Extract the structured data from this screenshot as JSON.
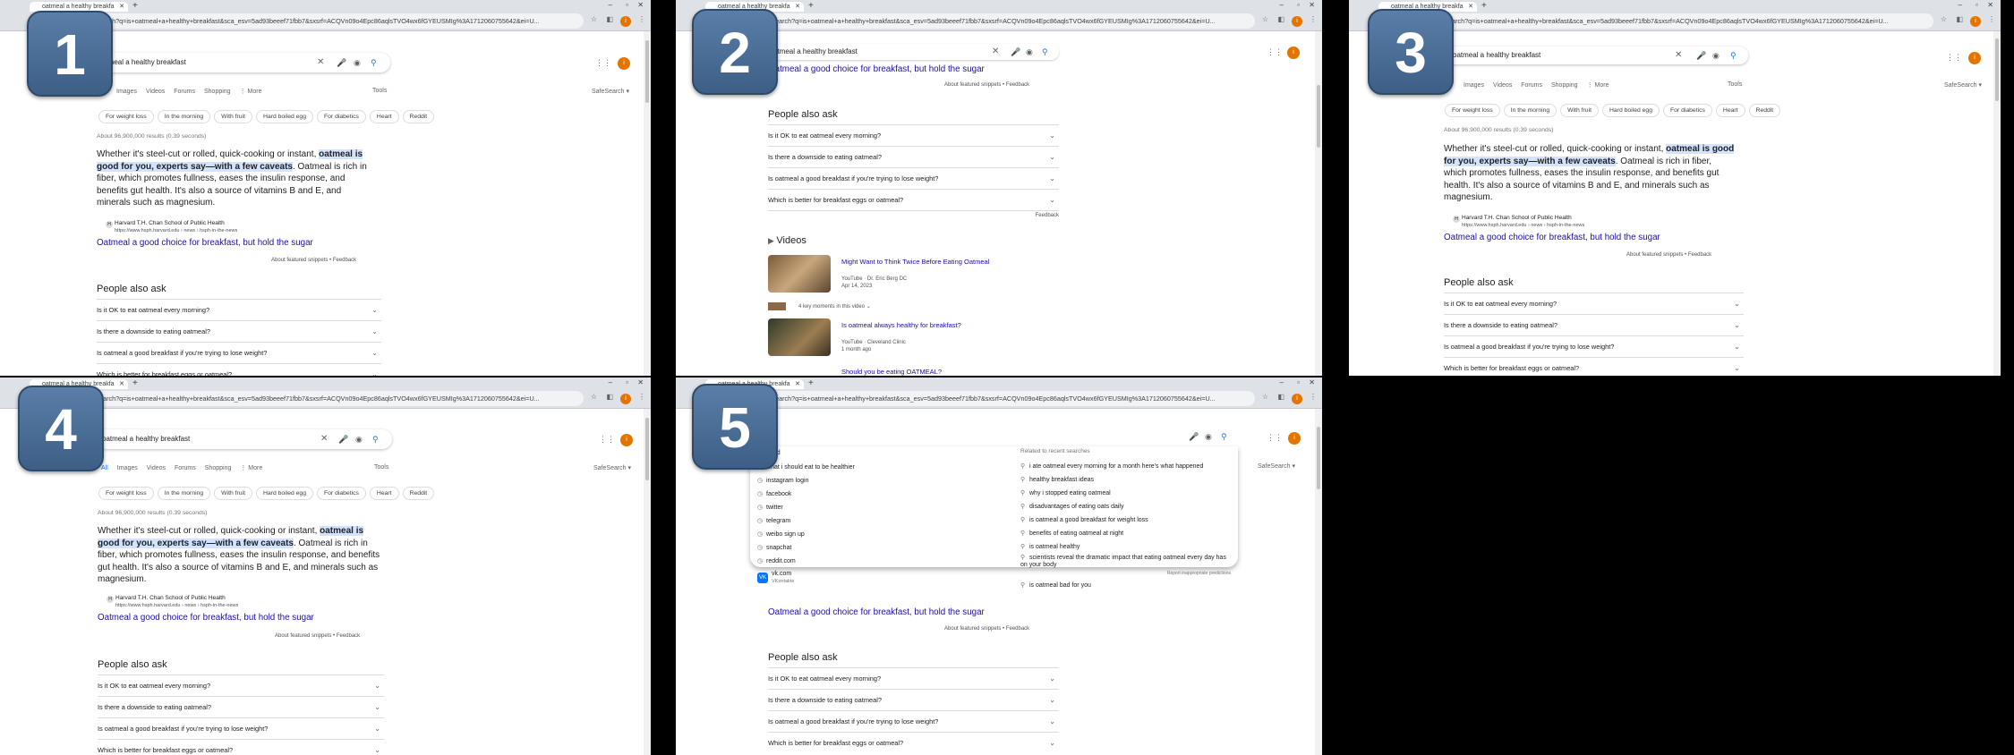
{
  "browser": {
    "tab_title": "oatmeal a healthy breakfa",
    "url": "e.com/search?q=is+oatmeal+a+healthy+breakfast&sca_esv=5ad93beeef71fbb7&sxsrf=ACQVn09o4Epc86aqlsTVO4wx6fGYEUSMIg%3A1712060755642&ei=U...",
    "avatar_letter": "i"
  },
  "search": {
    "query": "atmeal a healthy breakfast",
    "query_p2": "atmeal a healthy breakfast",
    "query_p3": "oatmeal a healthy breakfast",
    "query_p4": "oatmeal a healthy breakfast"
  },
  "tabs": {
    "all": "All",
    "images": "Images",
    "videos": "Videos",
    "forums": "Forums",
    "shopping": "Shopping",
    "more": "⋮ More",
    "tools": "Tools",
    "safesearch": "SafeSearch ▾"
  },
  "chips": [
    "For weight loss",
    "In the morning",
    "With fruit",
    "Hard boiled egg",
    "For diabetics",
    "Heart",
    "Reddit"
  ],
  "stats": "About 96,900,000 results (0.39 seconds)",
  "snippet": {
    "pre": "Whether it's steel-cut or rolled, quick-cooking or instant, ",
    "hl": "oatmeal is good for you, experts say—with a few caveats",
    "post": ". Oatmeal is rich in fiber, which promotes fullness, eases the insulin response, and benefits gut health. It's also a source of vitamins B and E, and minerals such as magnesium."
  },
  "source": {
    "name": "Harvard T.H. Chan School of Public Health",
    "url": "https://www.hsph.harvard.edu › news › hsph-in-the-news"
  },
  "result_title": "Oatmeal a good choice for breakfast, but hold the sugar",
  "about": "About featured snippets • Feedback",
  "paa": {
    "heading": "People also ask",
    "questions": [
      "Is it OK to eat oatmeal every morning?",
      "Is there a downside to eating oatmeal?",
      "Is oatmeal a good breakfast if you're trying to lose weight?",
      "Which is better for breakfast eggs or oatmeal?"
    ],
    "feedback": "Feedback"
  },
  "videos": {
    "heading": "Videos",
    "v1": {
      "title": "Might Want to Think Twice Before Eating Oatmeal",
      "channel": "YouTube · Dr. Eric Berg DC",
      "date": "Apr 14, 2023"
    },
    "moments": "4 key moments in this video",
    "v2": {
      "title": "Is oatmeal always healthy for breakfast?",
      "channel": "YouTube · Cleveland Clinic",
      "date": "1 month ago"
    },
    "v3": "Should you be eating OATMEAL?"
  },
  "dropdown": {
    "left": [
      "ead",
      "what i should eat to be healthier",
      "instagram login",
      "facebook",
      "twitter",
      "telegram",
      "weibo sign up",
      "snapchat",
      "reddit.com"
    ],
    "vk": {
      "title": "vk.com",
      "sub": "VKontakte"
    },
    "right_header": "Related to recent searches",
    "right": [
      "i ate oatmeal every morning for a month here's what happened",
      "healthy breakfast ideas",
      "why i stopped eating oatmeal",
      "disadvantages of eating oats daily",
      "is oatmeal a good breakfast for weight loss",
      "benefits of eating oatmeal at night",
      "is oatmeal healthy",
      "scientists reveal the dramatic impact that eating oatmeal every day has on your body",
      "is oatmeal bad for you"
    ],
    "report": "Report inappropriate predictions"
  },
  "badges": [
    "1",
    "2",
    "3",
    "4",
    "5"
  ]
}
